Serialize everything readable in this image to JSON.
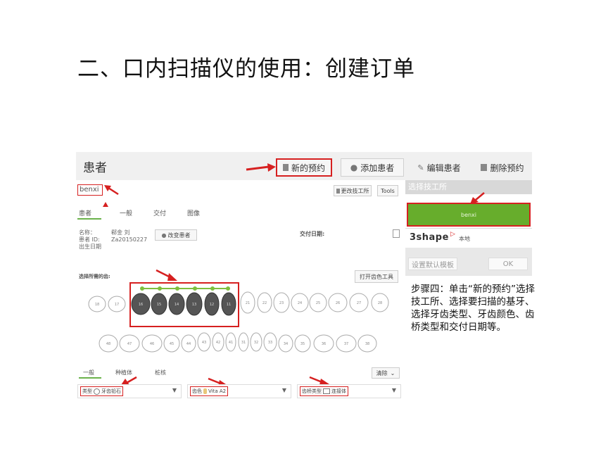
{
  "slide": {
    "title": "二、口内扫描仪的使用：创建订单",
    "step_text": "步骤四：单击“新的预约”选择技工所、选择要扫描的基牙、选择牙齿类型、牙齿颜色、齿桥类型和交付日期等。"
  },
  "app": {
    "title": "患者",
    "toolbar": {
      "new_order": "新的预约",
      "add_patient": "添加患者",
      "edit_patient": "编辑患者",
      "delete_order": "删除预约"
    },
    "search_value": "benxi",
    "change_lab_button": "更改技工所",
    "tools_button": "Tools",
    "tabs": [
      "患者",
      "一般",
      "交付",
      "图像"
    ],
    "patient": {
      "name_label": "名称：",
      "name_value": "郗金 刘",
      "id_label": "患者 ID:",
      "id_value": "Za20150227",
      "dob_label": "出生日期"
    },
    "change_patient_button": "改变患者",
    "delivery_date_label": "交付日期:",
    "select_teeth_label": "选择所需的齿:",
    "open_color_tool": "打开齿色工具",
    "upper_teeth": [
      "18",
      "17",
      "16",
      "15",
      "14",
      "13",
      "12",
      "11",
      "21",
      "22",
      "23",
      "24",
      "25",
      "26",
      "27",
      "28"
    ],
    "lower_teeth": [
      "48",
      "47",
      "46",
      "45",
      "44",
      "43",
      "42",
      "41",
      "31",
      "32",
      "33",
      "34",
      "35",
      "36",
      "37",
      "38"
    ],
    "clear_button": "清除",
    "bottom_tabs": [
      "一般",
      "种植体",
      "桩核"
    ],
    "type_label": "类型",
    "type_value": "牙齿铅石",
    "shade_label": "齿色",
    "shade_value": "Vita A2",
    "bridge_label": "齿桥类型",
    "bridge_value": "连接体"
  },
  "lab_panel": {
    "header": "选择技工所",
    "selected_lab": "benxi",
    "brand": "3shape",
    "local_label": "本地",
    "set_default_button": "设置默认模板",
    "ok_button": "OK"
  },
  "colors": {
    "accent_green": "#67ad2c",
    "highlight_red": "#d62020"
  }
}
